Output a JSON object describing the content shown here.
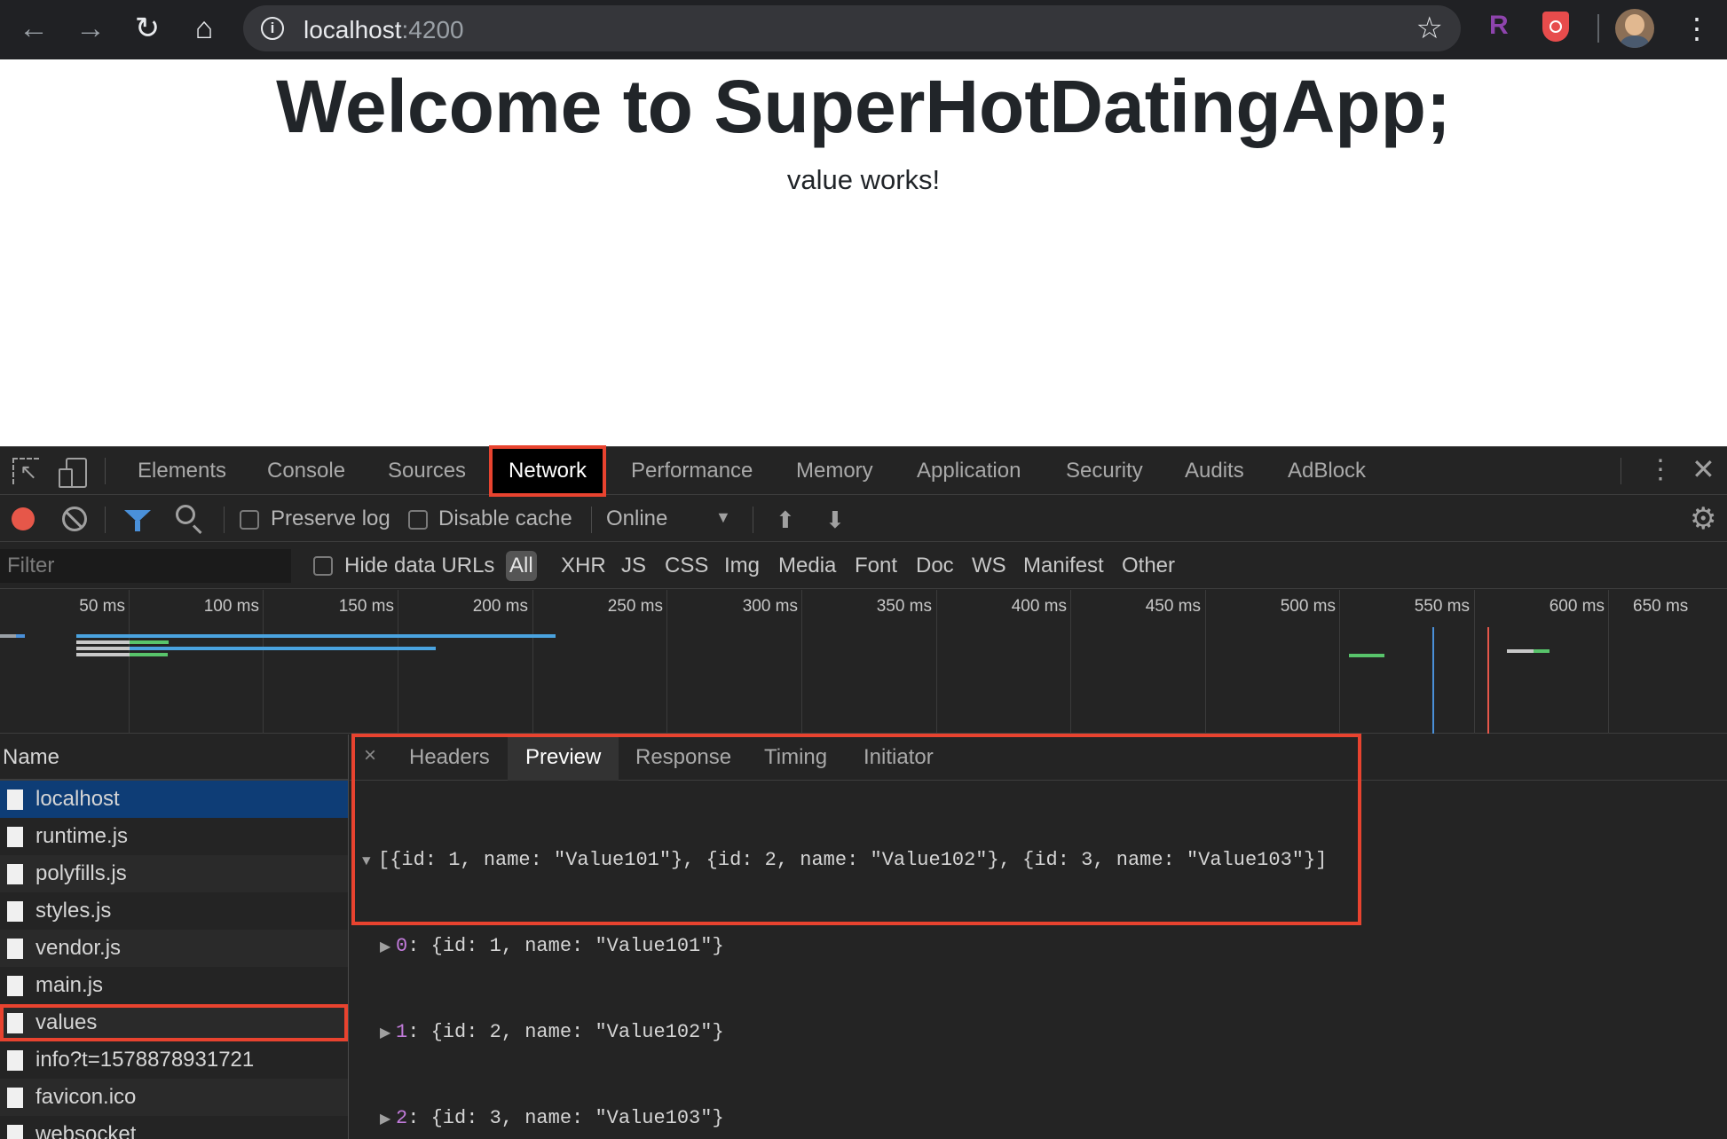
{
  "browser": {
    "url_host": "localhost",
    "url_port": ":4200"
  },
  "page": {
    "title": "Welcome to SuperHotDatingApp;",
    "subtitle": "value works!"
  },
  "devtools": {
    "tabs": [
      "Elements",
      "Console",
      "Sources",
      "Network",
      "Performance",
      "Memory",
      "Application",
      "Security",
      "Audits",
      "AdBlock"
    ],
    "selected_tab": "Network",
    "toolbar": {
      "preserve_log": "Preserve log",
      "disable_cache": "Disable cache",
      "throttling": "Online"
    },
    "filter": {
      "placeholder": "Filter",
      "hide_data_urls": "Hide data URLs",
      "types": [
        "All",
        "XHR",
        "JS",
        "CSS",
        "Img",
        "Media",
        "Font",
        "Doc",
        "WS",
        "Manifest",
        "Other"
      ]
    },
    "timeline": {
      "ticks": [
        "50 ms",
        "100 ms",
        "150 ms",
        "200 ms",
        "250 ms",
        "300 ms",
        "350 ms",
        "400 ms",
        "450 ms",
        "500 ms",
        "550 ms",
        "600 ms",
        "650 ms"
      ]
    },
    "requests": {
      "header": "Name",
      "items": [
        "localhost",
        "runtime.js",
        "polyfills.js",
        "styles.js",
        "vendor.js",
        "main.js",
        "values",
        "info?t=1578878931721",
        "favicon.ico",
        "websocket"
      ],
      "selected": "localhost",
      "highlighted": "values"
    },
    "detail": {
      "close": "×",
      "tabs": [
        "Headers",
        "Preview",
        "Response",
        "Timing",
        "Initiator"
      ],
      "selected_tab": "Preview",
      "preview": {
        "root": "[{id: 1, name: \"Value101\"}, {id: 2, name: \"Value102\"}, {id: 3, name: \"Value103\"}]",
        "children": [
          {
            "index": "0",
            "value": ": {id: 1, name: \"Value101\"}"
          },
          {
            "index": "1",
            "value": ": {id: 2, name: \"Value102\"}"
          },
          {
            "index": "2",
            "value": ": {id: 3, name: \"Value103\"}"
          }
        ]
      }
    }
  },
  "colors": {
    "accent_red": "#e8432f",
    "selection_blue": "#0e3d76",
    "record_red": "#e65749"
  },
  "icons": [
    "back-arrow-icon",
    "forward-arrow-icon",
    "reload-icon",
    "home-icon",
    "info-icon",
    "star-icon",
    "inspect-icon",
    "device-toggle-icon",
    "record-icon",
    "clear-icon",
    "filter-icon",
    "search-icon",
    "upload-icon",
    "download-icon",
    "gear-icon",
    "file-icon",
    "close-icon",
    "kebab-menu-icon"
  ]
}
